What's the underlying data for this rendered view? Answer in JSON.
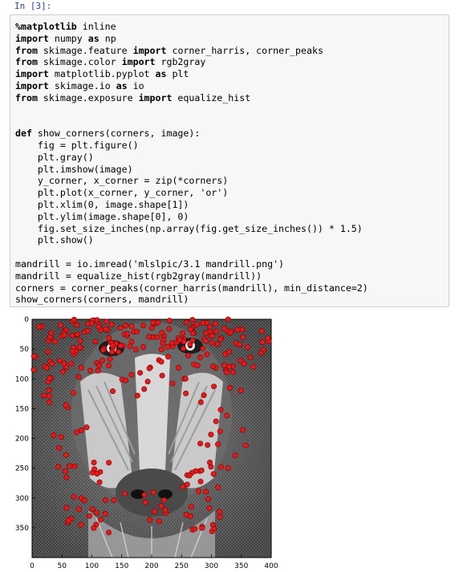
{
  "cell": {
    "prompt": "In [3]:",
    "lines": [
      {
        "parts": [
          {
            "t": "%matplotlib",
            "k": true
          },
          {
            "t": " inline",
            "k": false
          }
        ]
      },
      {
        "parts": [
          {
            "t": "import",
            "k": true
          },
          {
            "t": " numpy ",
            "k": false
          },
          {
            "t": "as",
            "k": true
          },
          {
            "t": " np",
            "k": false
          }
        ]
      },
      {
        "parts": [
          {
            "t": "from",
            "k": true
          },
          {
            "t": " skimage.feature ",
            "k": false
          },
          {
            "t": "import",
            "k": true
          },
          {
            "t": " corner_harris, corner_peaks",
            "k": false
          }
        ]
      },
      {
        "parts": [
          {
            "t": "from",
            "k": true
          },
          {
            "t": " skimage.color ",
            "k": false
          },
          {
            "t": "import",
            "k": true
          },
          {
            "t": " rgb2gray",
            "k": false
          }
        ]
      },
      {
        "parts": [
          {
            "t": "import",
            "k": true
          },
          {
            "t": " matplotlib.pyplot ",
            "k": false
          },
          {
            "t": "as",
            "k": true
          },
          {
            "t": " plt",
            "k": false
          }
        ]
      },
      {
        "parts": [
          {
            "t": "import",
            "k": true
          },
          {
            "t": " skimage.io ",
            "k": false
          },
          {
            "t": "as",
            "k": true
          },
          {
            "t": " io",
            "k": false
          }
        ]
      },
      {
        "parts": [
          {
            "t": "from",
            "k": true
          },
          {
            "t": " skimage.exposure ",
            "k": false
          },
          {
            "t": "import",
            "k": true
          },
          {
            "t": " equalize_hist",
            "k": false
          }
        ]
      },
      {
        "parts": []
      },
      {
        "parts": []
      },
      {
        "parts": [
          {
            "t": "def",
            "k": true
          },
          {
            "t": " show_corners(corners, image):",
            "k": false
          }
        ]
      },
      {
        "parts": [
          {
            "t": "    fig = plt.figure()",
            "k": false
          }
        ]
      },
      {
        "parts": [
          {
            "t": "    plt.gray()",
            "k": false
          }
        ]
      },
      {
        "parts": [
          {
            "t": "    plt.imshow(image)",
            "k": false
          }
        ]
      },
      {
        "parts": [
          {
            "t": "    y_corner, x_corner = zip(*corners)",
            "k": false
          }
        ]
      },
      {
        "parts": [
          {
            "t": "    plt.plot(x_corner, y_corner, 'or')",
            "k": false
          }
        ]
      },
      {
        "parts": [
          {
            "t": "    plt.xlim(0, image.shape[1])",
            "k": false
          }
        ]
      },
      {
        "parts": [
          {
            "t": "    plt.ylim(image.shape[0], 0)",
            "k": false
          }
        ]
      },
      {
        "parts": [
          {
            "t": "    fig.set_size_inches(np.array(fig.get_size_inches()) * 1.5)",
            "k": false
          }
        ]
      },
      {
        "parts": [
          {
            "t": "    plt.show()",
            "k": false
          }
        ]
      },
      {
        "parts": []
      },
      {
        "parts": [
          {
            "t": "mandrill = io.imread('mlslpic/3.1 mandrill.png')",
            "k": false
          }
        ]
      },
      {
        "parts": [
          {
            "t": "mandrill = equalize_hist(rgb2gray(mandrill))",
            "k": false
          }
        ]
      },
      {
        "parts": [
          {
            "t": "corners = corner_peaks(corner_harris(mandrill), min_distance=2)",
            "k": false
          }
        ]
      },
      {
        "parts": [
          {
            "t": "show_corners(corners, mandrill)",
            "k": false
          }
        ]
      }
    ]
  },
  "plot": {
    "x_ticks": [
      "0",
      "50",
      "100",
      "150",
      "200",
      "250",
      "300",
      "350",
      "400"
    ],
    "y_ticks": [
      "0",
      "50",
      "100",
      "150",
      "200",
      "250",
      "300",
      "350"
    ],
    "xlim": [
      0,
      400
    ],
    "ylim": [
      400,
      0
    ],
    "marker_color": "#e31a1c",
    "marker_edge": "#7a0000"
  }
}
